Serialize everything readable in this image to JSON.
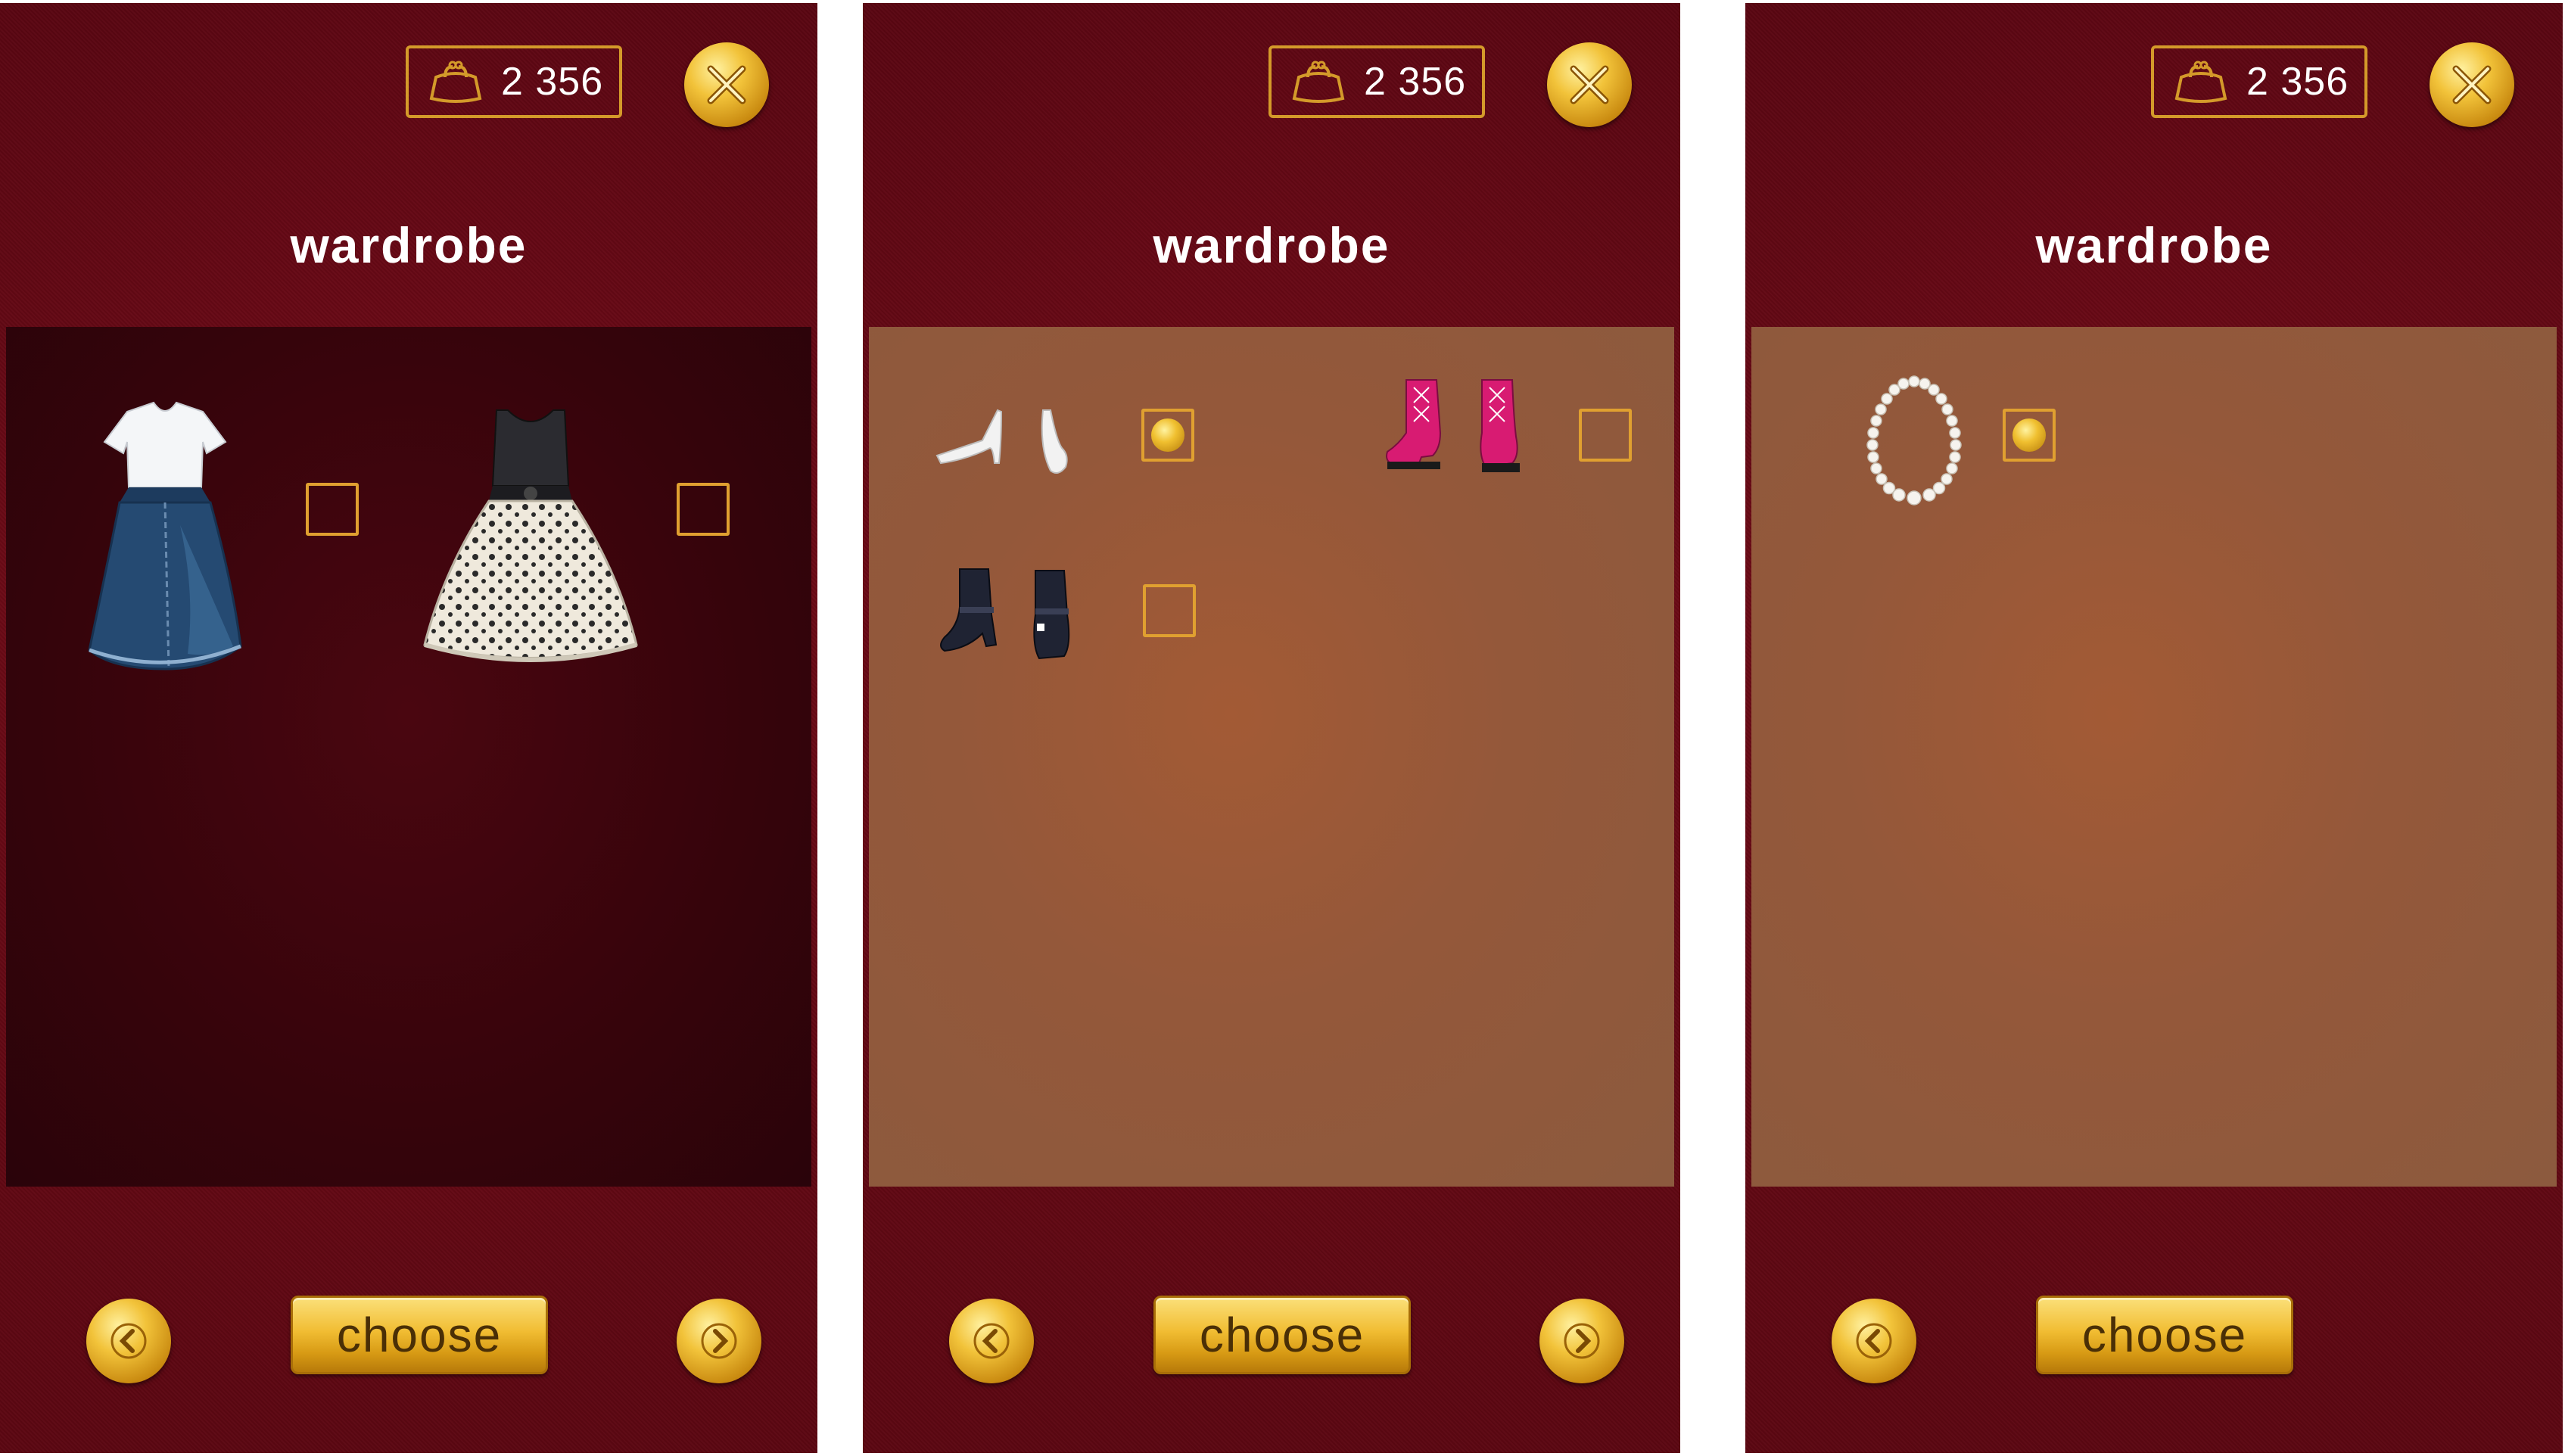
{
  "screens": [
    {
      "coins": "2 356",
      "title": "wardrobe",
      "panel_style": "dark",
      "items": [
        {
          "name": "denim-skirt-outfit",
          "selected": false
        },
        {
          "name": "polka-dot-dress",
          "selected": false
        }
      ],
      "choose_label": "choose"
    },
    {
      "coins": "2 356",
      "title": "wardrobe",
      "panel_style": "tan",
      "items": [
        {
          "name": "white-heels",
          "selected": true
        },
        {
          "name": "pink-lace-up-boots",
          "selected": false
        },
        {
          "name": "black-ankle-boots",
          "selected": false
        }
      ],
      "choose_label": "choose"
    },
    {
      "coins": "2 356",
      "title": "wardrobe",
      "panel_style": "tan",
      "items": [
        {
          "name": "pearl-necklace",
          "selected": true
        }
      ],
      "choose_label": "choose"
    }
  ],
  "icons": {
    "wallet": "purse-icon",
    "close": "close-icon",
    "prev": "chevron-left-icon",
    "next": "chevron-right-icon"
  },
  "colors": {
    "background": "#6b0a16",
    "accent_gold": "#f1bd33",
    "border_gold": "#d49a2a",
    "tan_panel": "#94583a"
  }
}
